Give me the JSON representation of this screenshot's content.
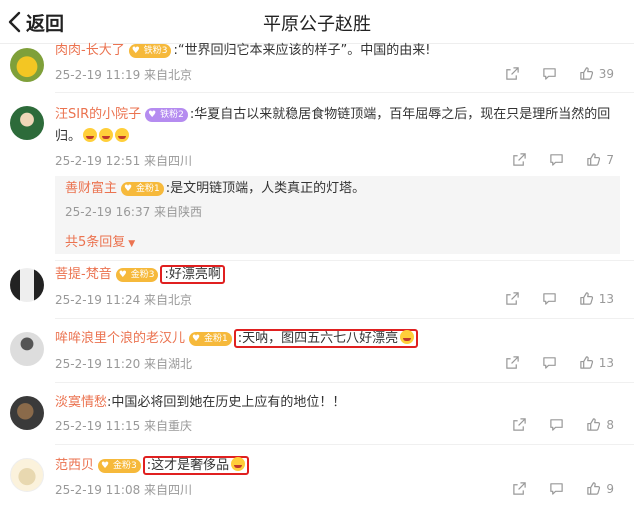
{
  "header": {
    "back_label": "返回",
    "title": "平原公子赵胜"
  },
  "comments": [
    {
      "user": "肉肉-长大了",
      "badge": "铁粉3",
      "text": ":“世界回归它本来应该的样子”。中国的由来!",
      "time": "25-2-19 11:19 来自北京",
      "likes": "39"
    },
    {
      "user": "汪SIR的小院子",
      "badge": "铁粉2",
      "text_line1": ":华夏自古以来就稳居食物链顶端，百年屈辱之后，现在只是理所当然的回",
      "text_line2": "归。",
      "time": "25-2-19 12:51 来自四川",
      "likes": "7",
      "reply": {
        "user": "善财富主",
        "badge": "金粉1",
        "text": ":是文明链顶端，人类真正的灯塔。",
        "time": "25-2-19 16:37 来自陕西"
      },
      "more_replies": "共5条回复"
    },
    {
      "user": "菩提-梵音",
      "badge": "金粉3",
      "text": ":好漂亮啊",
      "time": "25-2-19 11:24 来自北京",
      "likes": "13"
    },
    {
      "user": "哞哞浪里个浪的老汉儿",
      "badge": "金粉1",
      "text": ":天呐，图四五六七八好漂亮",
      "time": "25-2-19 11:20 来自湖北",
      "likes": "13"
    },
    {
      "user": "淡寞情愁",
      "badge": "",
      "text": ":中国必将回到她在历史上应有的地位！！",
      "time": "25-2-19 11:15 来自重庆",
      "likes": "8"
    },
    {
      "user": "范西贝",
      "badge": "金粉3",
      "text": ":这才是奢侈品",
      "time": "25-2-19 11:08 来自四川",
      "likes": "9"
    }
  ],
  "colors": {
    "username": "#eb7350",
    "highlight_box": "#e02020",
    "meta": "#999999"
  },
  "icons": {
    "back": "chevron-left-icon",
    "share": "share-icon",
    "comment": "comment-icon",
    "like": "thumbs-up-icon"
  }
}
